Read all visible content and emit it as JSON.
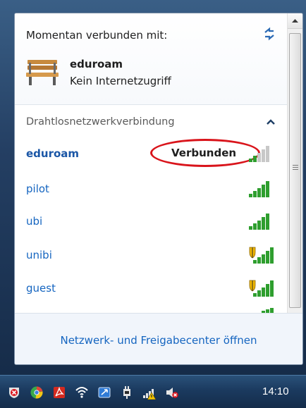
{
  "flyout": {
    "connected_title": "Momentan verbunden mit:",
    "current_network": {
      "name": "eduroam",
      "status": "Kein Internetzugriff"
    },
    "section_title": "Drahtlosnetzwerkverbindung",
    "networks": [
      {
        "name": "eduroam",
        "status": "Verbunden",
        "secured": false,
        "signal_bars": 2,
        "connected": true
      },
      {
        "name": "pilot",
        "status": "",
        "secured": false,
        "signal_bars": 5,
        "connected": false
      },
      {
        "name": "ubi",
        "status": "",
        "secured": false,
        "signal_bars": 5,
        "connected": false
      },
      {
        "name": "unibi",
        "status": "",
        "secured": true,
        "signal_bars": 5,
        "connected": false
      },
      {
        "name": "guest",
        "status": "",
        "secured": true,
        "signal_bars": 5,
        "connected": false
      }
    ],
    "footer_link": "Netzwerk- und Freigabecenter öffnen"
  },
  "taskbar": {
    "clock": "14:10",
    "tray_icons": [
      "security-alert-icon",
      "chrome-icon",
      "acrobat-icon",
      "wifi-icon",
      "sync-icon",
      "power-plug-icon",
      "network-warning-icon",
      "volume-muted-icon"
    ]
  },
  "colors": {
    "link_blue": "#1565c0",
    "signal_green": "#2e9e2e",
    "highlight_red": "#d9141b",
    "taskbar": "#1b3a5f"
  }
}
